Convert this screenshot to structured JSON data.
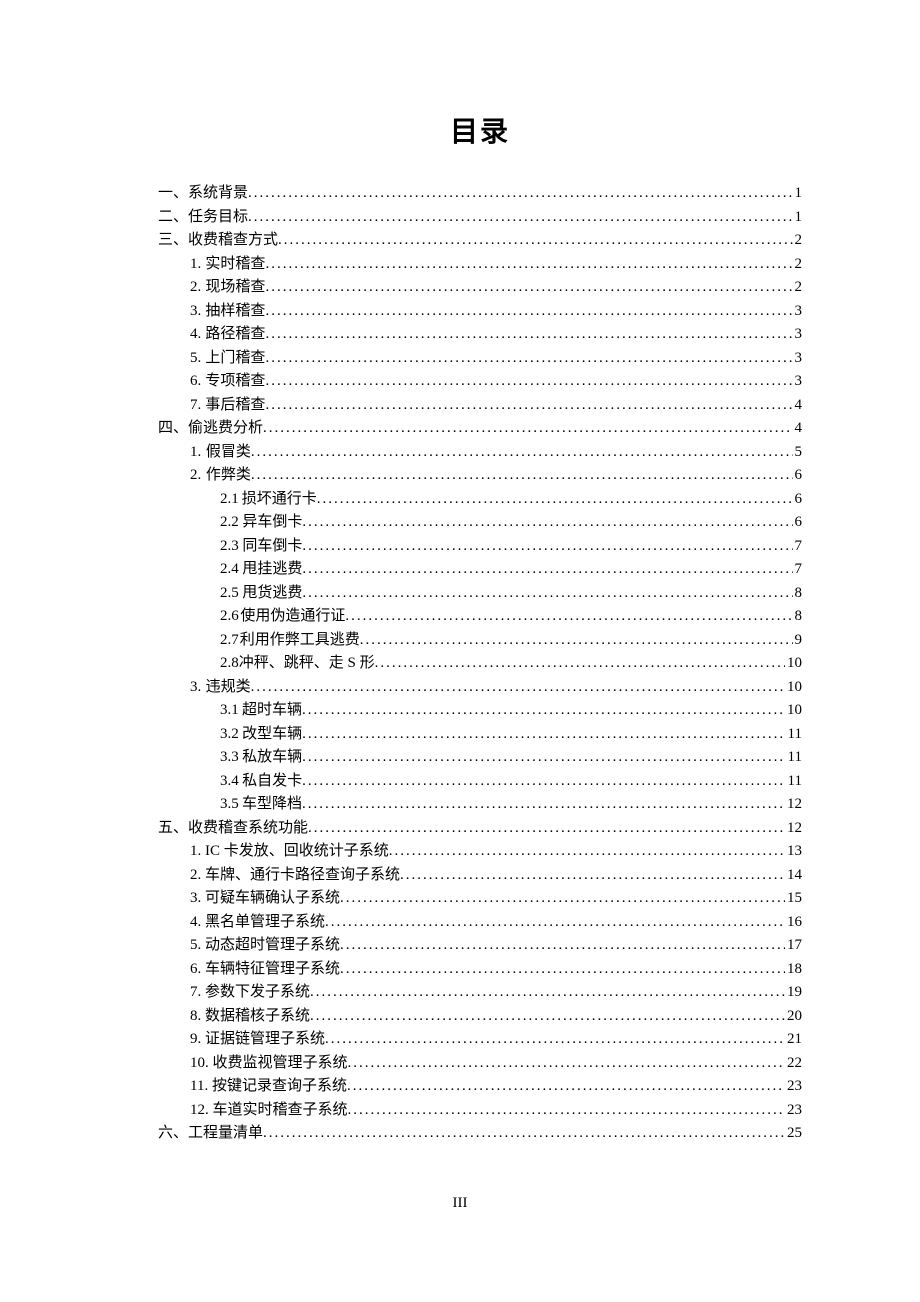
{
  "title": "目录",
  "footer": "III",
  "entries": [
    {
      "indent": 0,
      "num": "一、",
      "label": "系统背景",
      "page": "1"
    },
    {
      "indent": 0,
      "num": "二、",
      "label": "任务目标",
      "page": "1"
    },
    {
      "indent": 0,
      "num": "三、",
      "label": "收费稽查方式",
      "page": "2"
    },
    {
      "indent": 1,
      "num": "1.",
      "label": "实时稽查",
      "page": "2"
    },
    {
      "indent": 1,
      "num": "2.",
      "label": "现场稽查",
      "page": "2"
    },
    {
      "indent": 1,
      "num": "3.",
      "label": "抽样稽查",
      "page": "3"
    },
    {
      "indent": 1,
      "num": "4.",
      "label": "路径稽查",
      "page": "3"
    },
    {
      "indent": 1,
      "num": "5.",
      "label": "上门稽查",
      "page": "3"
    },
    {
      "indent": 1,
      "num": "6.",
      "label": "专项稽查",
      "page": "3"
    },
    {
      "indent": 1,
      "num": "7.",
      "label": "事后稽查",
      "page": "4"
    },
    {
      "indent": 0,
      "num": "四、",
      "label": "偷逃费分析",
      "page": "4"
    },
    {
      "indent": 1,
      "num": "1.",
      "label": "假冒类",
      "page": "5"
    },
    {
      "indent": 1,
      "num": "2.",
      "label": "作弊类",
      "page": "6"
    },
    {
      "indent": 2,
      "num": "2.1",
      "label": "损坏通行卡",
      "page": "6"
    },
    {
      "indent": 2,
      "num": "2.2",
      "label": "异车倒卡",
      "page": "6"
    },
    {
      "indent": 2,
      "num": "2.3",
      "label": "同车倒卡",
      "page": "7"
    },
    {
      "indent": 2,
      "num": "2.4",
      "label": "甩挂逃费",
      "page": "7"
    },
    {
      "indent": 2,
      "num": "2.5",
      "label": "甩货逃费",
      "page": "8"
    },
    {
      "indent": 2,
      "num": "2.6",
      "label": "使用伪造通行证",
      "page": "8"
    },
    {
      "indent": 2,
      "num": "2.7",
      "label": "利用作弊工具逃费",
      "page": "9"
    },
    {
      "indent": 2,
      "num": "2.8",
      "label": "冲秤、跳秤、走 S 形 ",
      "page": "10"
    },
    {
      "indent": 1,
      "num": "3.",
      "label": "违规类",
      "page": "10"
    },
    {
      "indent": 2,
      "num": "3.1",
      "label": "超时车辆",
      "page": "10"
    },
    {
      "indent": 2,
      "num": "3.2",
      "label": "改型车辆",
      "page": "11"
    },
    {
      "indent": 2,
      "num": "3.3",
      "label": "私放车辆",
      "page": "11"
    },
    {
      "indent": 2,
      "num": "3.4",
      "label": "私自发卡",
      "page": "11"
    },
    {
      "indent": 2,
      "num": "3.5",
      "label": "车型降档",
      "page": "12"
    },
    {
      "indent": 0,
      "num": "五、",
      "label": "收费稽查系统功能",
      "page": "12"
    },
    {
      "indent": 1,
      "num": "",
      "label": "1. IC 卡发放、回收统计子系统",
      "page": "13",
      "flat": true
    },
    {
      "indent": 1,
      "num": "",
      "label": "2. 车牌、通行卡路径查询子系统",
      "page": "14",
      "flat": true
    },
    {
      "indent": 1,
      "num": "",
      "label": "3. 可疑车辆确认子系统",
      "page": "15",
      "flat": true
    },
    {
      "indent": 1,
      "num": "",
      "label": "4. 黑名单管理子系统",
      "page": "16",
      "flat": true
    },
    {
      "indent": 1,
      "num": "",
      "label": "5. 动态超时管理子系统",
      "page": "17",
      "flat": true
    },
    {
      "indent": 1,
      "num": "",
      "label": "6. 车辆特征管理子系统",
      "page": "18",
      "flat": true
    },
    {
      "indent": 1,
      "num": "",
      "label": "7. 参数下发子系统",
      "page": "19",
      "flat": true
    },
    {
      "indent": 1,
      "num": "",
      "label": "8. 数据稽核子系统",
      "page": "20",
      "flat": true
    },
    {
      "indent": 1,
      "num": "",
      "label": "9. 证据链管理子系统",
      "page": "21",
      "flat": true
    },
    {
      "indent": 1,
      "num": "",
      "label": "10. 收费监视管理子系统",
      "page": "22",
      "flat": true
    },
    {
      "indent": 1,
      "num": "",
      "label": "11. 按键记录查询子系统",
      "page": "23",
      "flat": true
    },
    {
      "indent": 1,
      "num": "",
      "label": "12. 车道实时稽查子系统",
      "page": "23",
      "flat": true
    },
    {
      "indent": 0,
      "num": "六、",
      "label": "工程量清单",
      "page": "25"
    }
  ]
}
